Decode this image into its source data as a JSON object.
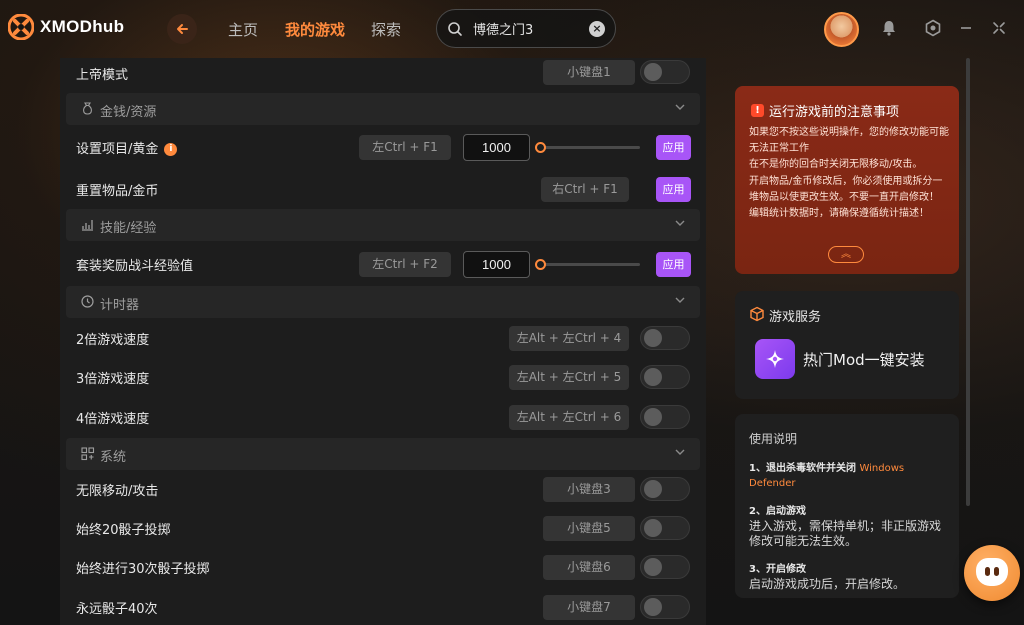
{
  "app": {
    "logo_text": "XMODhub"
  },
  "nav": {
    "tabs": [
      {
        "label": "主页"
      },
      {
        "label": "我的游戏"
      },
      {
        "label": "探索"
      }
    ],
    "active_tab": "我的游戏"
  },
  "search": {
    "value": "博德之门3"
  },
  "colors": {
    "accent": "#ff8a3d",
    "apply_button": "#a855f7",
    "notice_background": "#7a2512"
  },
  "mods": {
    "god_mode": {
      "label": "上帝模式",
      "hotkey": "小键盘1"
    },
    "section_money": {
      "label": "金钱/资源"
    },
    "set_item_gold": {
      "label": "设置项目/黄金",
      "hotkey": "左Ctrl + F1",
      "value": "1000",
      "apply": "应用",
      "info": "i"
    },
    "reset_item_coin": {
      "label": "重置物品/金币",
      "hotkey": "右Ctrl + F1",
      "apply": "应用"
    },
    "section_skill": {
      "label": "技能/经验"
    },
    "set_exp": {
      "label": "套装奖励战斗经验值",
      "hotkey": "左Ctrl + F2",
      "value": "1000",
      "apply": "应用"
    },
    "section_timer": {
      "label": "计时器"
    },
    "speed_2x": {
      "label": "2倍游戏速度",
      "hotkey": "左Alt + 左Ctrl + 4"
    },
    "speed_3x": {
      "label": "3倍游戏速度",
      "hotkey": "左Alt + 左Ctrl + 5"
    },
    "speed_4x": {
      "label": "4倍游戏速度",
      "hotkey": "左Alt + 左Ctrl + 6"
    },
    "section_system": {
      "label": "系统"
    },
    "unlimited_move": {
      "label": "无限移动/攻击",
      "hotkey": "小键盘3"
    },
    "dice_20": {
      "label": "始终20骰子投掷",
      "hotkey": "小键盘5"
    },
    "dice_30": {
      "label": "始终进行30次骰子投掷",
      "hotkey": "小键盘6"
    },
    "dice_40": {
      "label": "永远骰子40次",
      "hotkey": "小键盘7"
    }
  },
  "notice": {
    "title": "运行游戏前的注意事项",
    "lines": [
      "如果您不按这些说明操作，您的修改功能可能无法正常工作",
      "在不是你的回合时关闭无限移动/攻击。",
      "开启物品/金币修改后，你必须使用或拆分一堆物品以使更改生效。不要一直开启修改！",
      "编辑统计数据时，请确保遵循统计描述！"
    ],
    "collapse": "︽"
  },
  "service": {
    "title": "游戏服务",
    "button_label": "热门Mod一键安装"
  },
  "guide": {
    "title": "使用说明",
    "step1_title": "1、退出杀毒软件并关闭",
    "step1_highlight": "Windows Defender",
    "step2_title": "2、启动游戏",
    "step2_text": "进入游戏，需保持单机；非正版游戏修改可能无法生效。",
    "step3_title": "3、开启修改",
    "step3_text": "启动游戏成功后，开启修改。"
  }
}
